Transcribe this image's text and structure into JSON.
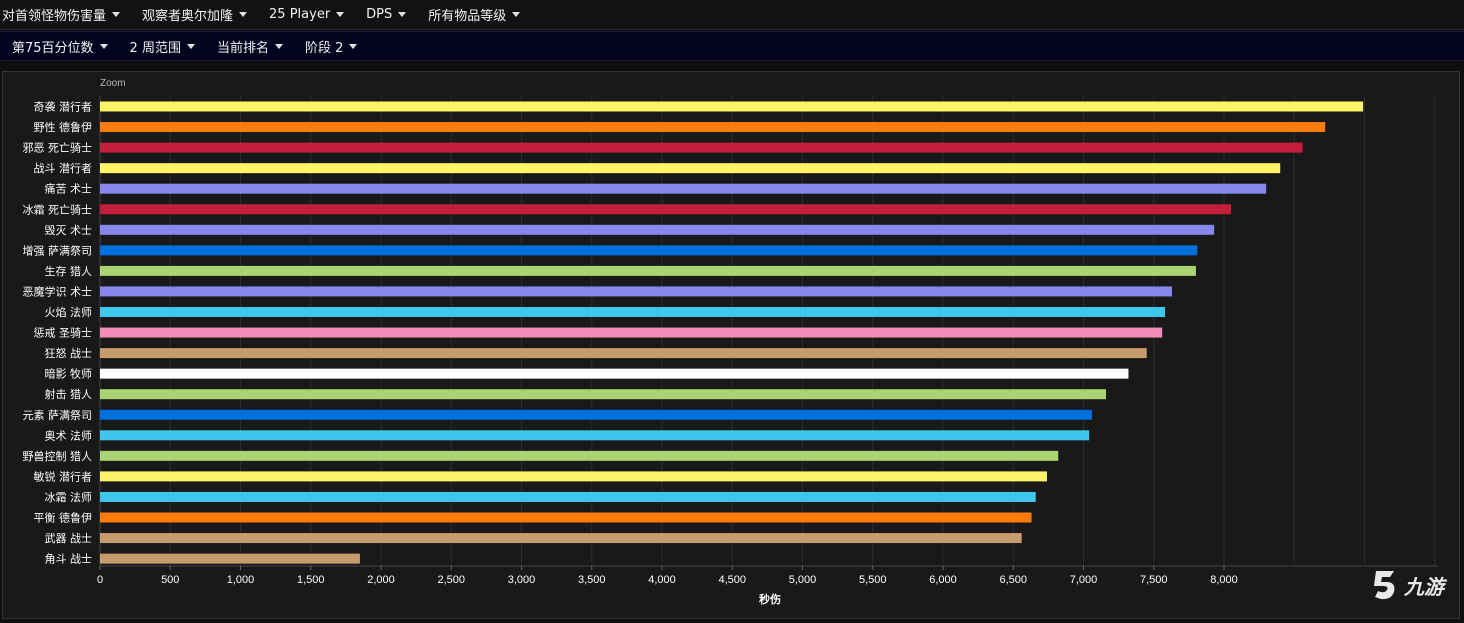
{
  "filters_row1": [
    {
      "label": "对首领怪物伤害量"
    },
    {
      "label": "观察者奥尔加隆"
    },
    {
      "label": "25 Player"
    },
    {
      "label": "DPS"
    },
    {
      "label": "所有物品等级"
    }
  ],
  "filters_row2": [
    {
      "label": "第75百分位数"
    },
    {
      "label": "2 周范围"
    },
    {
      "label": "当前排名"
    },
    {
      "label": "阶段 2"
    }
  ],
  "zoom_label": "Zoom",
  "watermark_text": "九游",
  "chart_data": {
    "type": "bar",
    "orientation": "horizontal",
    "categories": [
      "奇袭 潜行者",
      "野性 德鲁伊",
      "邪恶 死亡骑士",
      "战斗 潜行者",
      "痛苦 术士",
      "冰霜 死亡骑士",
      "毁灭 术士",
      "增强 萨满祭司",
      "生存 猎人",
      "恶魔学识 术士",
      "火焰 法师",
      "惩戒 圣骑士",
      "狂怒 战士",
      "暗影 牧师",
      "射击 猎人",
      "元素 萨满祭司",
      "奥术 法师",
      "野兽控制 猎人",
      "敏锐 潜行者",
      "冰霜 法师",
      "平衡 德鲁伊",
      "武器 战士",
      "角斗 战士"
    ],
    "values": [
      8990,
      8720,
      8560,
      8400,
      8300,
      8050,
      7930,
      7810,
      7800,
      7630,
      7580,
      7560,
      7450,
      7320,
      7160,
      7060,
      7040,
      6820,
      6740,
      6660,
      6630,
      6560,
      1850
    ],
    "colors": [
      "#fff468",
      "#ff7c0a",
      "#c41e3a",
      "#fff468",
      "#8788ee",
      "#c41e3a",
      "#8788ee",
      "#0070dd",
      "#aad372",
      "#8788ee",
      "#3fc7eb",
      "#f48cba",
      "#c69b6d",
      "#ffffff",
      "#aad372",
      "#0070dd",
      "#3fc7eb",
      "#aad372",
      "#fff468",
      "#3fc7eb",
      "#ff7c0a",
      "#c69b6d",
      "#c69b6d"
    ],
    "xlim": [
      0,
      9500
    ],
    "xticks": [
      0,
      500,
      1000,
      1500,
      2000,
      2500,
      3000,
      3500,
      4000,
      4500,
      5000,
      5500,
      6000,
      6500,
      7000,
      7500,
      8000
    ],
    "xtick_labels": [
      "0",
      "500",
      "1,000",
      "1,500",
      "2,000",
      "2,500",
      "3,000",
      "3,500",
      "4,000",
      "4,500",
      "5,000",
      "5,500",
      "6,000",
      "6,500",
      "7,000",
      "7,500",
      "8,000"
    ],
    "xlabel": "秒伤",
    "grid": true
  }
}
